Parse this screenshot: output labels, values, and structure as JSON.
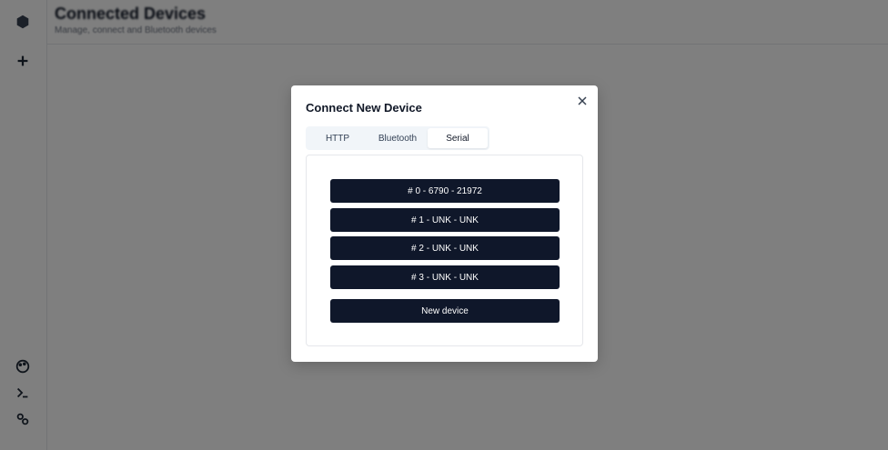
{
  "page": {
    "title": "Connected Devices",
    "subtitle": "Manage, connect and Bluetooth devices"
  },
  "sidebar": {
    "icons": [
      "app-logo-icon",
      "add-icon",
      "palette-icon",
      "terminal-icon",
      "settings-icon"
    ]
  },
  "modal": {
    "title": "Connect New Device",
    "tabs": [
      {
        "label": "HTTP",
        "active": false
      },
      {
        "label": "Bluetooth",
        "active": false
      },
      {
        "label": "Serial",
        "active": true
      }
    ],
    "devices": [
      {
        "label": "# 0 - 6790 - 21972"
      },
      {
        "label": "# 1 - UNK - UNK"
      },
      {
        "label": "# 2 - UNK - UNK"
      },
      {
        "label": "# 3 - UNK - UNK"
      }
    ],
    "new_device_label": "New device"
  },
  "colors": {
    "button_bg": "#0f172a",
    "overlay": "rgba(0,0,0,0.5)"
  }
}
